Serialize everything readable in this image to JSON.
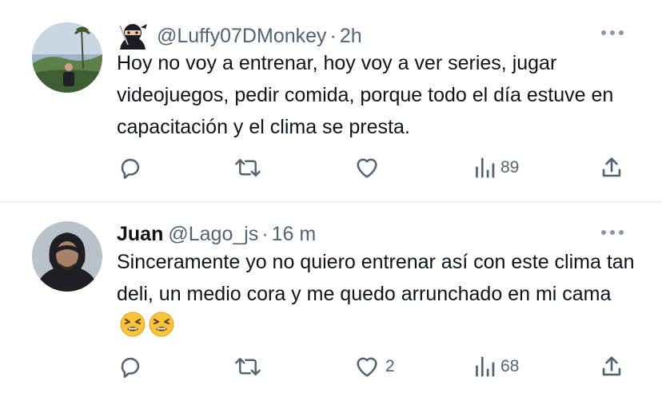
{
  "tweets": [
    {
      "display_name": "",
      "name_emoji": "ninja-emoji",
      "handle": "@Luffy07DMonkey",
      "dot": "·",
      "time": "2h",
      "text": "Hoy no voy a entrenar, hoy voy a ver series, jugar videojuegos, pedir comida, porque todo el día estuve en capacitación y el clima se presta.",
      "actions": {
        "reply": "",
        "retweet": "",
        "like": "",
        "views": "89"
      }
    },
    {
      "display_name": "Juan",
      "handle": "@Lago_js",
      "dot": "·",
      "time": "16 m",
      "text": "Sinceramente yo no quiero entrenar así con este clima tan deli, un medio cora y me quedo arrunchado en mi cama",
      "trailing_emojis": [
        "tired-face-emoji",
        "tired-face-emoji"
      ],
      "actions": {
        "reply": "",
        "retweet": "",
        "like": "2",
        "views": "68"
      }
    }
  ],
  "colors": {
    "text": "#0f1419",
    "secondary": "#536471",
    "divider": "#e6e9ec"
  }
}
